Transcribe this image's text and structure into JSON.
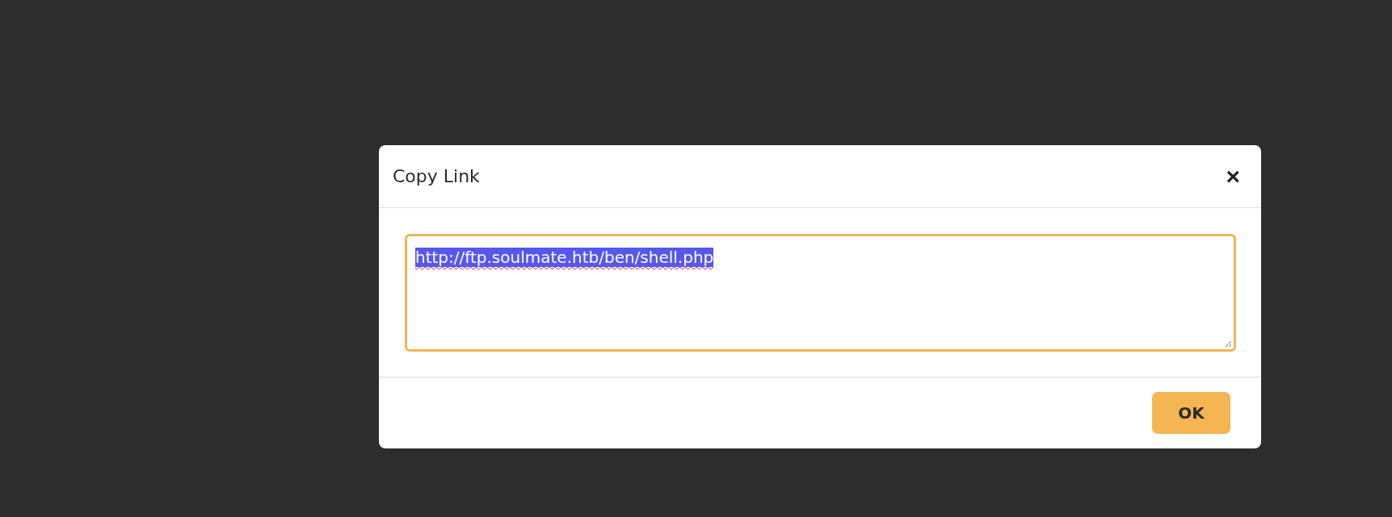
{
  "dialog": {
    "title": "Copy Link",
    "close": "×",
    "link_field": {
      "value": "http://ftp.soulmate.htb/ben/shell.php",
      "selected": true
    },
    "buttons": [
      "OK"
    ]
  }
}
